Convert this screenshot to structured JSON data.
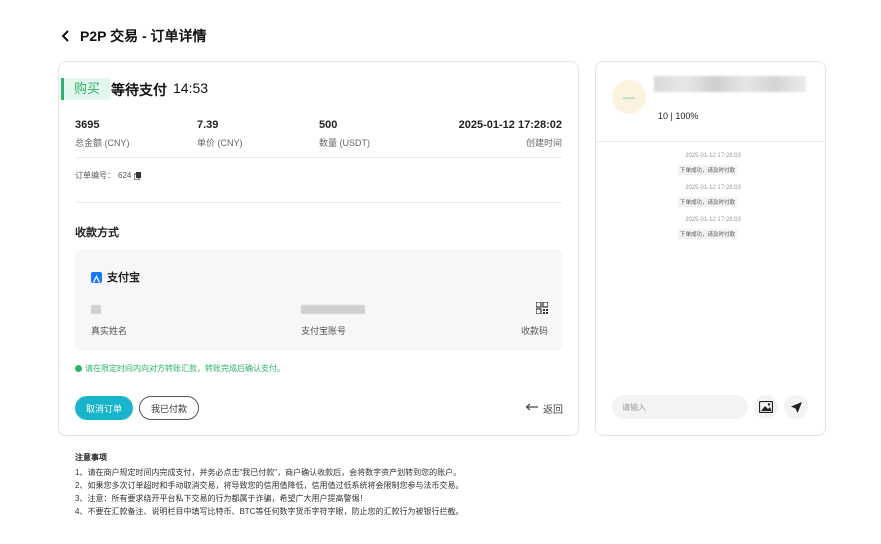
{
  "header": {
    "title": "P2P 交易 - 订单详情"
  },
  "order": {
    "badge": "购买",
    "status": "等待支付",
    "countdown": "14:53",
    "stats": [
      {
        "value": "3695",
        "label": "总金额 (CNY)"
      },
      {
        "value": "7.39",
        "label": "单价 (CNY)"
      },
      {
        "value": "500",
        "label": "数量 (USDT)"
      },
      {
        "value": "2025-01-12 17:28:02",
        "label": "创建时间"
      }
    ],
    "order_no_label": "订单编号：",
    "order_no_value": "624"
  },
  "payment": {
    "section_title": "收款方式",
    "method": "支付宝",
    "fields": [
      {
        "label": "真实姓名"
      },
      {
        "label": "支付宝账号"
      },
      {
        "label": "收款码"
      }
    ]
  },
  "notice": "请在限定时间内向对方转账汇款，转账完成后确认支付。",
  "actions": {
    "cancel": "取消订单",
    "paid": "我已付款",
    "back": "返回"
  },
  "chat": {
    "avatar_text": "—",
    "rating": "10 | 100%",
    "messages": [
      {
        "time": "2025-01-12 17:28:03",
        "text": "下单成功，请及时付款"
      },
      {
        "time": "2025-01-12 17:28:03",
        "text": "下单成功，请及时付款"
      },
      {
        "time": "2025-01-12 17:28:03",
        "text": "下单成功，请及时付款"
      }
    ],
    "input_placeholder": "请输入"
  },
  "notes": {
    "title": "注意事项",
    "lines": [
      "1、请在商户规定时间内完成支付，并务必点击\"我已付款\"，商户确认收款后，会将数字资产划转到您的账户。",
      "2、如果您多次订单超时和手动取消交易，将导致您的信用值降低，信用值过低系统将会限制您参与法币交易。",
      "3、注意：所有要求绕开平台私下交易的行为都属于诈骗，希望广大用户提高警惕！",
      "4、不要在汇款备注、说明栏目中填写比特币、BTC等任何数字货币字符字眼，防止您的汇款行为被银行拦截。"
    ]
  },
  "colors": {
    "accent": "#18b4c9",
    "buy_green": "#2db36b",
    "alipay_blue": "#1677ff"
  }
}
